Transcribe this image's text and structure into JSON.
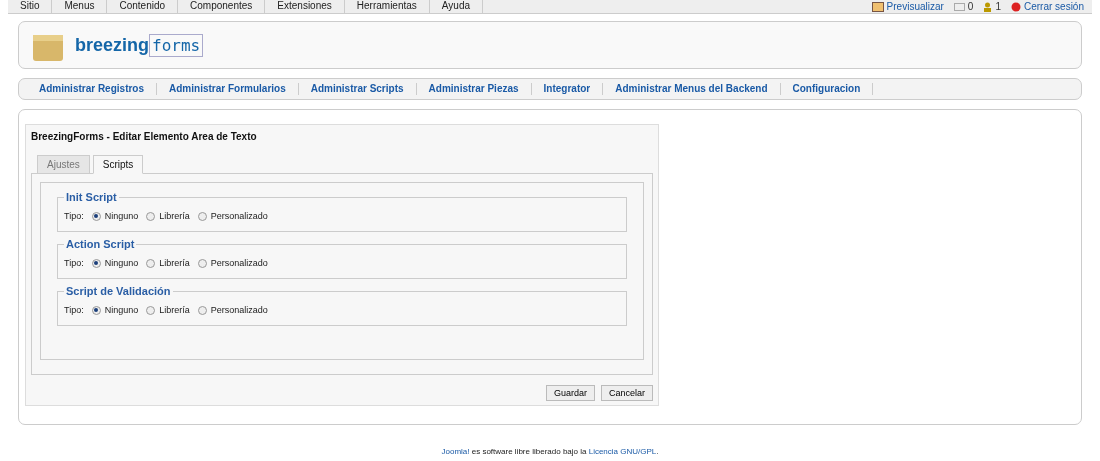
{
  "top_menu": [
    "Sitio",
    "Menus",
    "Contenido",
    "Componentes",
    "Extensiones",
    "Herramientas",
    "Ayuda"
  ],
  "status": [
    {
      "kind": "preview",
      "label": "Previsualizar"
    },
    {
      "kind": "messages",
      "label": "0"
    },
    {
      "kind": "users",
      "label": "1"
    },
    {
      "kind": "logout",
      "label": "Cerrar sesión"
    }
  ],
  "logo": {
    "bold": "breezing",
    "light": "forms"
  },
  "submenu": [
    "Administrar Registros",
    "Administrar Formularios",
    "Administrar Scripts",
    "Administrar Piezas",
    "Integrator",
    "Administrar Menus del Backend",
    "Configuracion"
  ],
  "dialog": {
    "title": "BreezingForms - Editar Elemento Area de Texto",
    "tabs": [
      {
        "label": "Ajustes",
        "selected": false
      },
      {
        "label": "Scripts",
        "selected": true
      }
    ],
    "sections": [
      {
        "legend": "Init Script",
        "field_label": "Tipo:",
        "options": [
          {
            "label": "Ninguno",
            "selected": true
          },
          {
            "label": "Librería",
            "selected": false
          },
          {
            "label": "Personalizado",
            "selected": false
          }
        ]
      },
      {
        "legend": "Action Script",
        "field_label": "Tipo:",
        "options": [
          {
            "label": "Ninguno",
            "selected": true
          },
          {
            "label": "Librería",
            "selected": false
          },
          {
            "label": "Personalizado",
            "selected": false
          }
        ]
      },
      {
        "legend": "Script de Validación",
        "field_label": "Tipo:",
        "options": [
          {
            "label": "Ninguno",
            "selected": true
          },
          {
            "label": "Librería",
            "selected": false
          },
          {
            "label": "Personalizado",
            "selected": false
          }
        ]
      }
    ],
    "buttons": [
      "Guardar",
      "Cancelar"
    ]
  },
  "footer": {
    "link_1": "Joomla!",
    "text": " es software libre liberado bajo la ",
    "link_2": "Licencia GNU/GPL",
    "end": "."
  }
}
